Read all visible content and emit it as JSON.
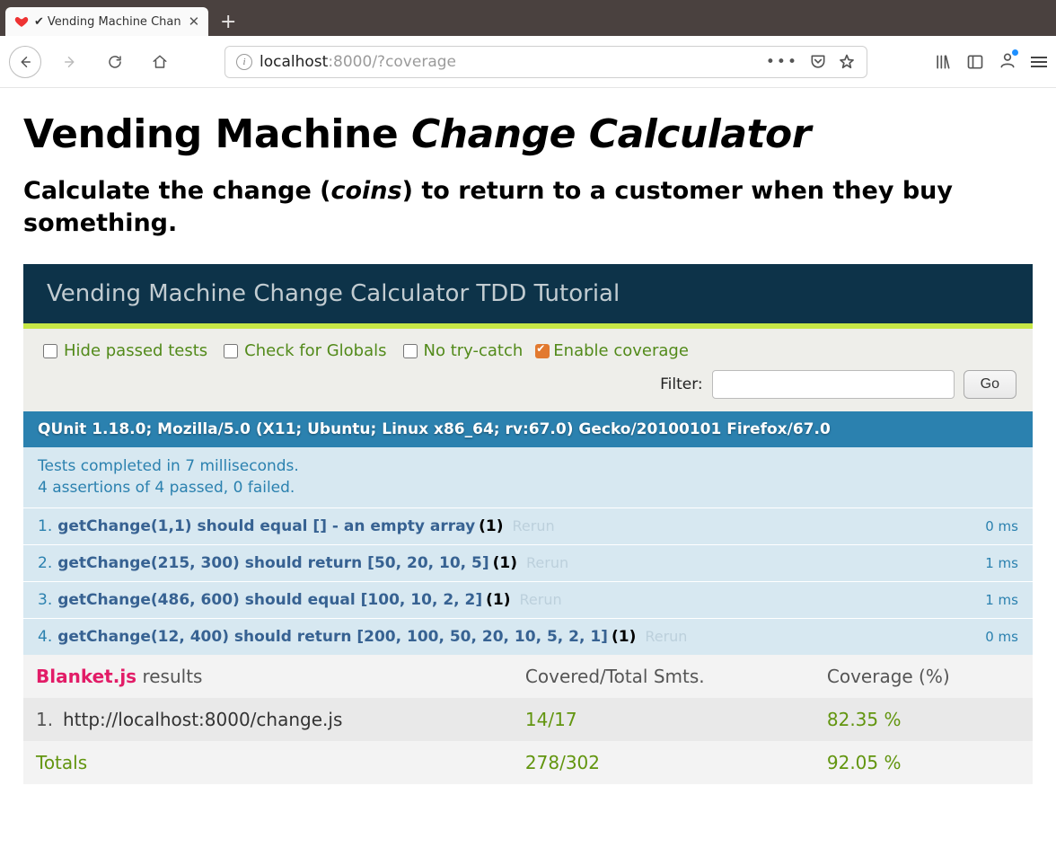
{
  "browser": {
    "tab_check": "✔",
    "tab_title": "Vending Machine Chan",
    "url_host": "localhost",
    "url_port": ":8000",
    "url_path": "/?coverage"
  },
  "page": {
    "h1_a": "Vending Machine ",
    "h1_b": "Change Calculator",
    "h2_a": "Calculate the change (",
    "h2_b": "coins",
    "h2_c": ") to return to a customer when they buy something."
  },
  "qunit": {
    "header": "Vending Machine Change Calculator TDD Tutorial",
    "opt_hide": "Hide passed tests",
    "opt_globals": "Check for Globals",
    "opt_notry": "No try-catch",
    "opt_cov": "Enable coverage",
    "filter_label": "Filter:",
    "filter_value": "",
    "go": "Go",
    "useragent": "QUnit 1.18.0; Mozilla/5.0 (X11; Ubuntu; Linux x86_64; rv:67.0) Gecko/20100101 Firefox/67.0",
    "summary_l1": "Tests completed in 7 milliseconds.",
    "summary_l2": "4 assertions of 4 passed, 0 failed.",
    "rerun": "Rerun",
    "tests": [
      {
        "idx": "1.",
        "name": "getChange(1,1) should equal [] - an empty array",
        "count": "(1)",
        "time": "0 ms"
      },
      {
        "idx": "2.",
        "name": "getChange(215, 300) should return [50, 20, 10, 5]",
        "count": "(1)",
        "time": "1 ms"
      },
      {
        "idx": "3.",
        "name": "getChange(486, 600) should equal [100, 10, 2, 2]",
        "count": "(1)",
        "time": "1 ms"
      },
      {
        "idx": "4.",
        "name": "getChange(12, 400) should return [200, 100, 50, 20, 10, 5, 2, 1]",
        "count": "(1)",
        "time": "0 ms"
      }
    ]
  },
  "blanket": {
    "title_a": "Blanket.js",
    "title_b": " results",
    "col_covered": "Covered/Total Smts.",
    "col_coverage": "Coverage (%)",
    "row_idx": "1.",
    "row_file": "http://localhost:8000/change.js",
    "row_covered": "14/17",
    "row_pct": "82.35 %",
    "totals_label": "Totals",
    "totals_covered": "278/302",
    "totals_pct": "92.05 %"
  }
}
